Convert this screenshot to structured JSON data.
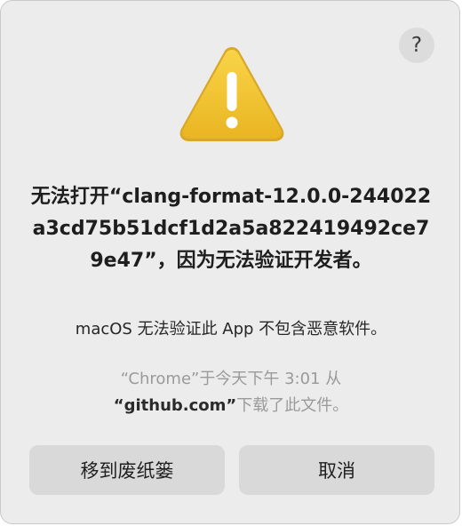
{
  "dialog": {
    "help_label": "?",
    "icon": "warning-triangle-icon",
    "title": "无法打开“clang-format-12.0.0-244022a3cd75b51dcf1d2a5a822419492ce79e47”，因为无法验证开发者。",
    "subtitle": "macOS 无法验证此 App 不包含恶意软件。",
    "source_line1_pre": "“Chrome”于今天下午 3:01 从",
    "source_line2_strong": "“github.com”",
    "source_line2_post": "下载了此文件。",
    "buttons": {
      "move_to_trash": "移到废纸篓",
      "cancel": "取消"
    }
  },
  "colors": {
    "background": "#ececec",
    "button": "#d9d9d9",
    "warning_yellow": "#f2c230",
    "secondary_text": "#9a9a9a"
  }
}
